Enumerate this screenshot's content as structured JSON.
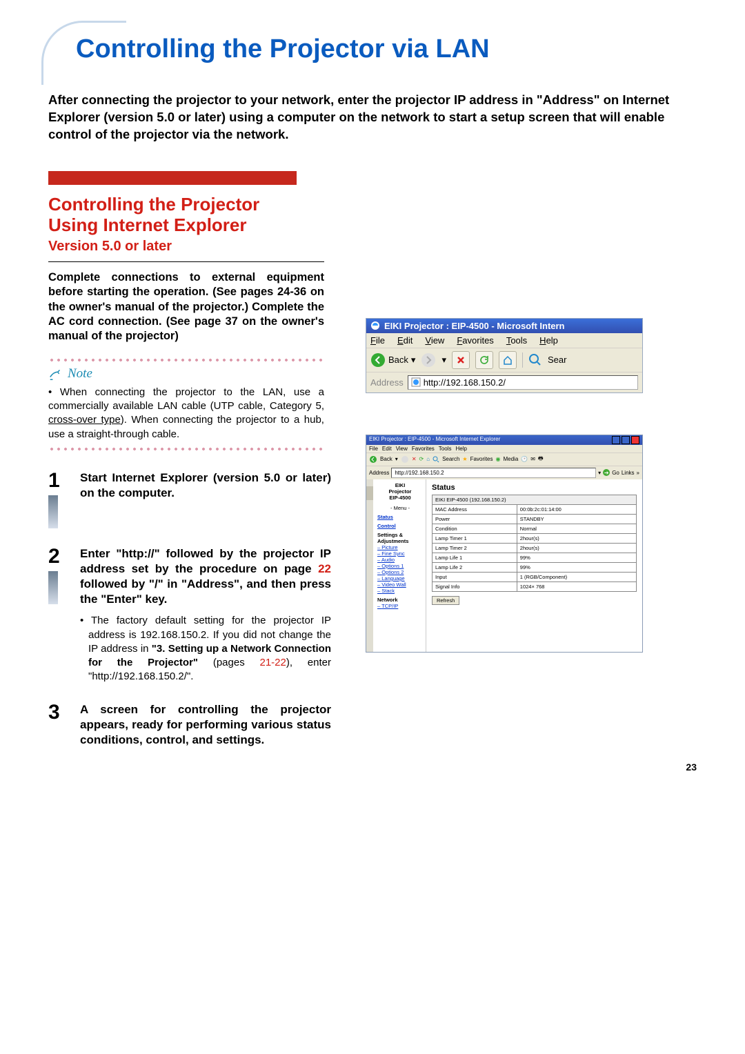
{
  "page": {
    "title": "Controlling the Projector via LAN",
    "intro": "After connecting the projector to your network, enter the projector IP address in \"Address\" on Internet Explorer (version 5.0 or later) using a computer on the network to start a setup screen that will enable control of the projector via the network.",
    "page_number": "23"
  },
  "section": {
    "title_l1": "Controlling the Projector",
    "title_l2": "Using Internet Explorer",
    "version": "Version 5.0 or later",
    "prep": "Complete connections to external equipment before starting the operation. (See pages 24-36 on the owner's manual of the projector.) Complete the AC cord connection. (See page 37 on the owner's manual of the projector)"
  },
  "note": {
    "label": "Note",
    "body_pre": "When connecting the projector to the LAN, use a commercially available LAN cable (UTP cable, Category 5, ",
    "body_under": "cross-over type",
    "body_post": "). When connecting the projector to a hub, use a straight-through cable."
  },
  "steps": {
    "s1": {
      "num": "1",
      "bold": "Start Internet Explorer (version 5.0 or later) on the computer."
    },
    "s2": {
      "num": "2",
      "bold_pre": "Enter \"http://\" followed by the projector IP address set by the procedure on page ",
      "bold_link": "22",
      "bold_post": " followed by \"/\" in \"Address\", and then press the \"Enter\" key.",
      "sub_pre": "The factory default setting for the projector IP address is 192.168.150.2. If you did not change the IP address in ",
      "sub_bold": "\"3. Setting up a Network Connection for the Projector\"",
      "sub_post1": " (pages ",
      "sub_link": "21-22",
      "sub_post2": "), enter \"http://192.168.150.2/\"."
    },
    "s3": {
      "num": "3",
      "bold": "A screen for controlling the projector appears, ready for performing various status conditions, control, and settings."
    }
  },
  "browser1": {
    "title": "EIKI Projector : EIP-4500 - Microsoft Intern",
    "menu": {
      "file": "File",
      "edit": "Edit",
      "view": "View",
      "fav": "Favorites",
      "tools": "Tools",
      "help": "Help"
    },
    "back": "Back",
    "search": "Sear",
    "addr_label": "Address",
    "addr_value": "http://192.168.150.2/"
  },
  "browser2": {
    "title": "EIKI Projector : EIP-4500 - Microsoft Internet Explorer",
    "menu": {
      "file": "File",
      "edit": "Edit",
      "view": "View",
      "fav": "Favorites",
      "tools": "Tools",
      "help": "Help"
    },
    "back": "Back",
    "search": "Search",
    "favorites": "Favorites",
    "media": "Media",
    "addr_label": "Address",
    "addr_value": "http://192.168.150.2",
    "go": "Go",
    "links": "Links",
    "sidebar": {
      "brand": "EIKI",
      "prod1": "Projector",
      "prod2": "EIP-4500",
      "menu_label": "- Menu -",
      "status": "Status",
      "control": "Control",
      "settings": "Settings &",
      "adjust": "Adjustments",
      "picture": "Picture",
      "finesync": "Fine Sync",
      "audio": "Audio",
      "opt1": "Options 1",
      "opt2": "Options 2",
      "lang": "Language",
      "wall": "Video Wall",
      "stack": "Stack",
      "network": "Network",
      "tcpip": "TCP/IP"
    },
    "main": {
      "heading": "Status",
      "device": "EIKI EIP-4500 (192.168.150.2)",
      "rows": [
        {
          "k": "MAC Address",
          "v": "00:0b:2c:01:14:00"
        },
        {
          "k": "Power",
          "v": "STANDBY"
        },
        {
          "k": "Condition",
          "v": "Normal"
        },
        {
          "k": "Lamp Timer 1",
          "v": "2hour(s)"
        },
        {
          "k": "Lamp Timer 2",
          "v": "2hour(s)"
        },
        {
          "k": "Lamp Life 1",
          "v": "99%"
        },
        {
          "k": "Lamp Life 2",
          "v": "99%"
        },
        {
          "k": "Input",
          "v": "1 (RGB/Component)"
        },
        {
          "k": "Signal Info",
          "v": "1024× 768"
        }
      ],
      "refresh": "Refresh"
    }
  }
}
